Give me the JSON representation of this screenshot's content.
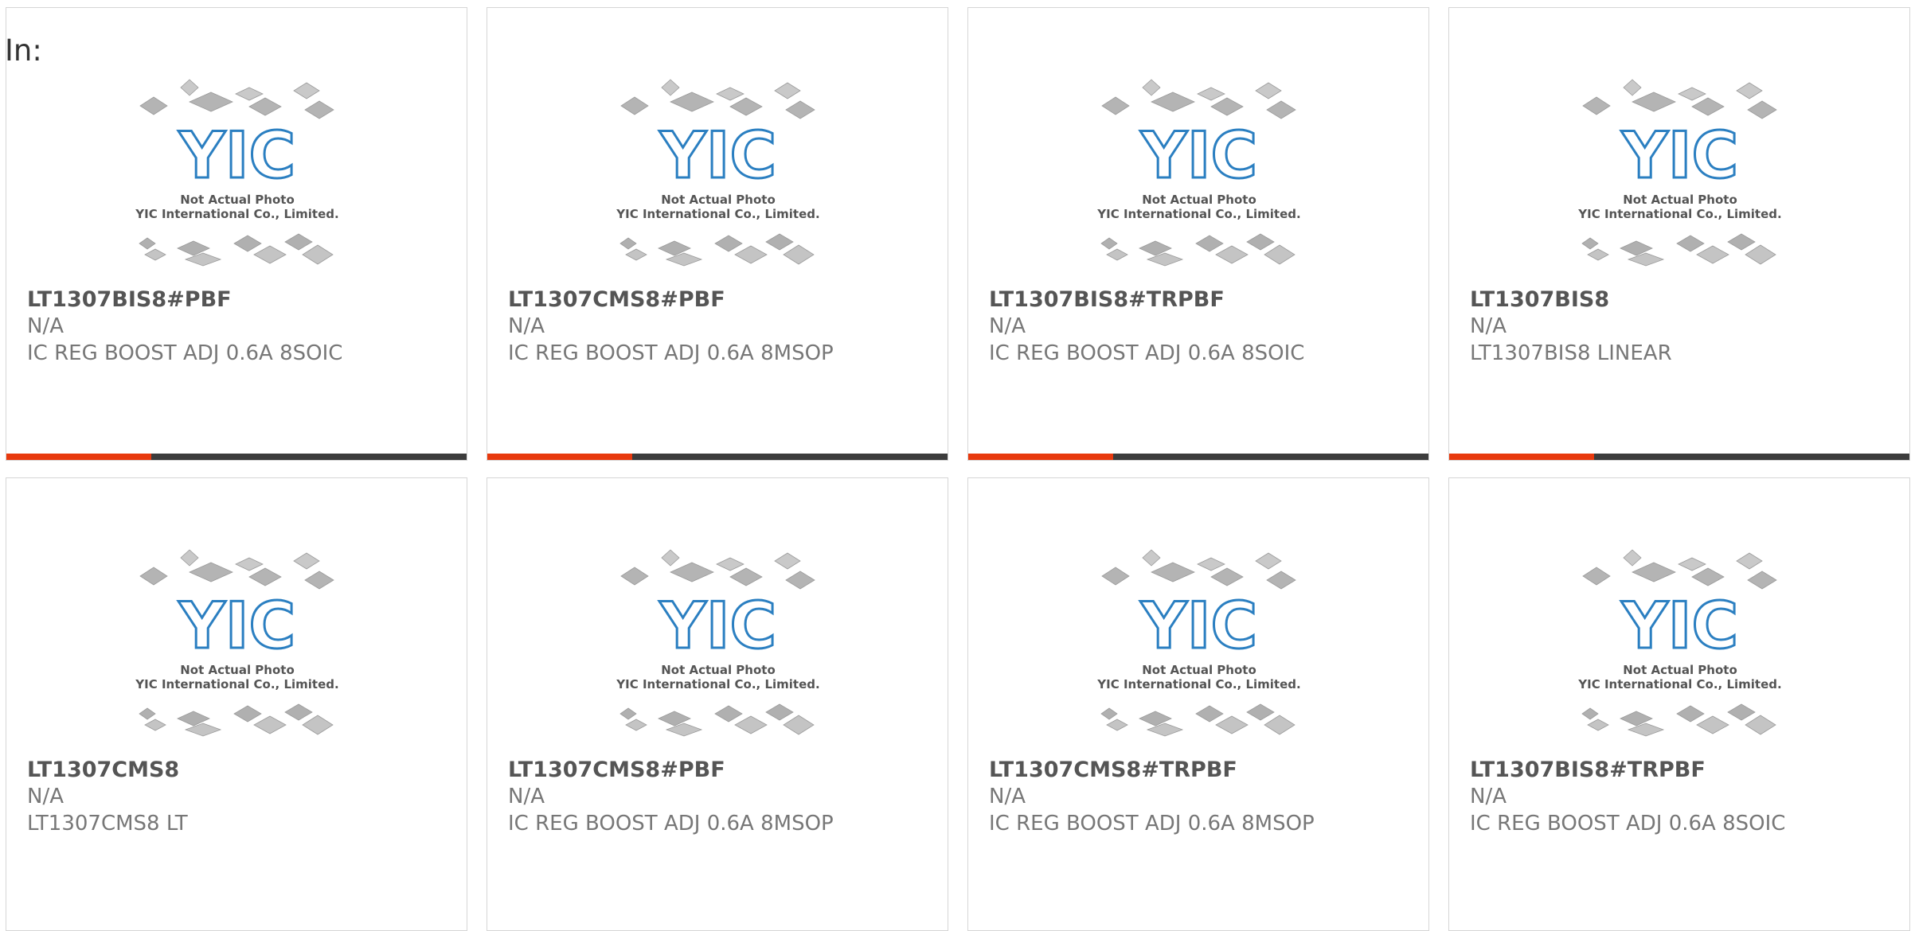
{
  "heading": "In:",
  "accent_color": "#e8390e",
  "bar_color": "#3c3c3c",
  "logo_color": "#2b7fc1",
  "photo_caption": [
    "Not Actual Photo",
    "YIC International Co., Limited."
  ],
  "products": [
    {
      "part": "LT1307BIS8#PBF",
      "mfr": "N/A",
      "desc": "IC REG BOOST ADJ 0.6A 8SOIC"
    },
    {
      "part": "LT1307CMS8#PBF",
      "mfr": "N/A",
      "desc": "IC REG BOOST ADJ 0.6A 8MSOP"
    },
    {
      "part": "LT1307BIS8#TRPBF",
      "mfr": "N/A",
      "desc": "IC REG BOOST ADJ 0.6A 8SOIC"
    },
    {
      "part": "LT1307BIS8",
      "mfr": "N/A",
      "desc": "LT1307BIS8 LINEAR"
    },
    {
      "part": "LT1307CMS8",
      "mfr": "N/A",
      "desc": "LT1307CMS8 LT"
    },
    {
      "part": "LT1307CMS8#PBF",
      "mfr": "N/A",
      "desc": "IC REG BOOST ADJ 0.6A 8MSOP"
    },
    {
      "part": "LT1307CMS8#TRPBF",
      "mfr": "N/A",
      "desc": "IC REG BOOST ADJ 0.6A 8MSOP"
    },
    {
      "part": "LT1307BIS8#TRPBF",
      "mfr": "N/A",
      "desc": "IC REG BOOST ADJ 0.6A 8SOIC"
    }
  ]
}
